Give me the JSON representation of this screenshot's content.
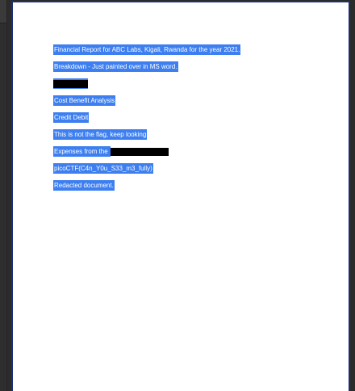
{
  "document": {
    "lines": [
      {
        "text": "Financial Report for ABC Labs, Kigali, Rwanda for the year 2021."
      },
      {
        "text": "Breakdown - Just painted over in MS word."
      },
      {
        "text": ""
      },
      {
        "text": "Cost Benefit Analysis"
      },
      {
        "text": "Credit Debit"
      },
      {
        "text": "This is not the flag, keep looking"
      },
      {
        "text": "Expenses from the"
      },
      {
        "text": "picoCTF(C4n_Y0u_S33_m3_fully)"
      },
      {
        "text": "Redacted document."
      }
    ]
  },
  "colors": {
    "highlight": "#3d7ff0",
    "redaction": "#000000",
    "page_border": "#1b2f7a",
    "background": "#2b2b2b"
  }
}
